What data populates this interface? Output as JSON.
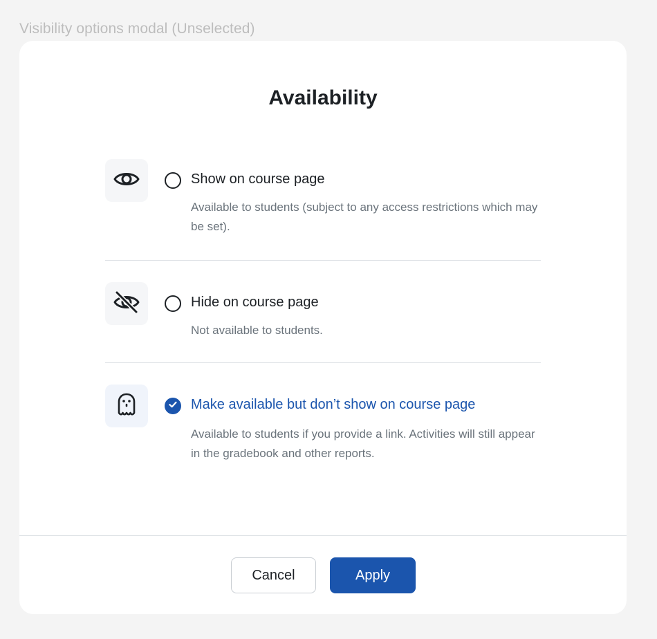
{
  "caption": "Visibility options modal (Unselected)",
  "modal": {
    "title": "Availability",
    "options": [
      {
        "icon": "eye-icon",
        "label": "Show on course page",
        "description": "Available to students (subject to any access restrictions which may be set).",
        "selected": false
      },
      {
        "icon": "eye-slash-icon",
        "label": "Hide on course page",
        "description": "Not available to students.",
        "selected": false
      },
      {
        "icon": "ghost-icon",
        "label": "Make available but don’t show on course page",
        "description": "Available to students if you provide a link. Activities will still appear in the gradebook and other reports.",
        "selected": true
      }
    ],
    "buttons": {
      "cancel": "Cancel",
      "apply": "Apply"
    }
  },
  "colors": {
    "accent": "#1b55ad",
    "text": "#1d2125",
    "muted": "#6a737b",
    "background": "#f4f4f4"
  }
}
